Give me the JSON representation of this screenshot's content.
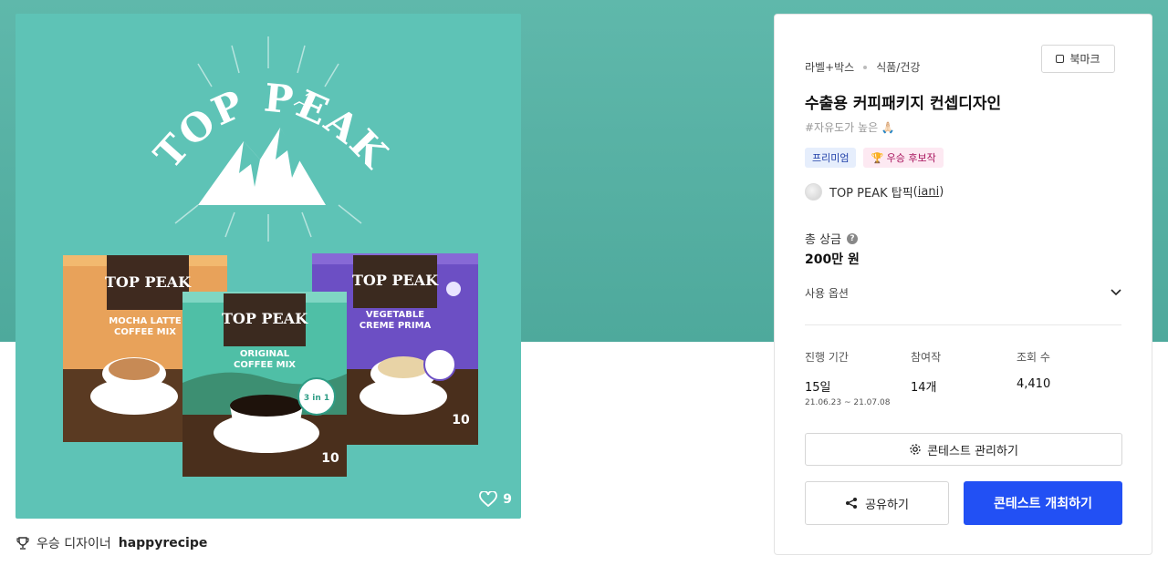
{
  "artwork": {
    "brand": "TOP PEAK",
    "boxes": [
      {
        "brand": "TOP PEAK",
        "line1": "MOCHA LATTE",
        "line2": "COFFEE MIX",
        "count": "10"
      },
      {
        "brand": "TOP PEAK",
        "line1": "ORIGINAL",
        "line2": "COFFEE MIX",
        "count": "10",
        "badge": "3 in 1"
      },
      {
        "brand": "TOP PEAK",
        "line1": "VEGETABLE",
        "line2": "CREME PRIMA",
        "count": "10"
      }
    ],
    "likes": "9"
  },
  "winner": {
    "label": "우승 디자이너",
    "name": "happyrecipe"
  },
  "panel": {
    "category_1": "라벨+박스",
    "category_2": "식품/건강",
    "bookmark_label": "북마크",
    "title": "수출용 커피패키지 컨셉디자인",
    "tagline": "#자유도가 높은 🙏🏻",
    "badge_premium": "프리미엄",
    "badge_winner": "🏆 우승 후보작",
    "owner_name": "TOP PEAK 탑픽",
    "owner_id": "iani",
    "prize_label": "총 상금",
    "prize_value": "200만 원",
    "usage_label": "사용 옵션",
    "stats": {
      "period_label": "진행 기간",
      "period_value": "15일",
      "period_range": "21.06.23 ~ 21.07.08",
      "entries_label": "참여작",
      "entries_value": "14개",
      "views_label": "조회 수",
      "views_value": "4,410"
    },
    "manage_label": "콘테스트 관리하기",
    "share_label": "공유하기",
    "host_label": "콘테스트 개최하기"
  },
  "colors": {
    "hero_bg": "#55ada0",
    "artwork_bg": "#5ec3b6",
    "primary_button": "#2250f4",
    "premium_badge_bg": "#e6eefc",
    "winner_badge_bg": "#fde9f2"
  }
}
